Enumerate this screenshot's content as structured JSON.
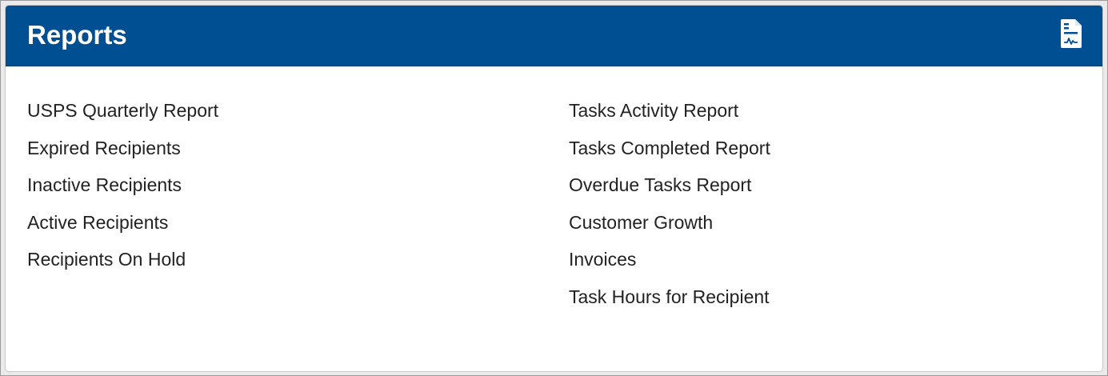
{
  "panel": {
    "title": "Reports",
    "icon": "report-document-icon",
    "header_color": "#004f93"
  },
  "left_reports": [
    {
      "label": "USPS Quarterly Report"
    },
    {
      "label": "Expired Recipients"
    },
    {
      "label": "Inactive Recipients"
    },
    {
      "label": "Active Recipients"
    },
    {
      "label": "Recipients On Hold"
    }
  ],
  "right_reports": [
    {
      "label": "Tasks Activity Report"
    },
    {
      "label": "Tasks Completed Report"
    },
    {
      "label": "Overdue Tasks Report"
    },
    {
      "label": "Customer Growth"
    },
    {
      "label": "Invoices"
    },
    {
      "label": "Task Hours for Recipient"
    }
  ]
}
